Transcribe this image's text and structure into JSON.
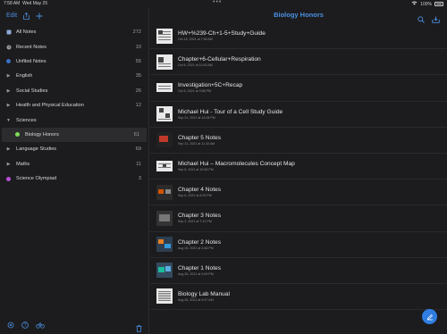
{
  "status": {
    "time": "7:58 AM",
    "date": "Wed May 25",
    "dots": "•••",
    "battery": "100%"
  },
  "sidebar": {
    "edit_label": "Edit",
    "items": [
      {
        "label": "All Notes",
        "count": "272",
        "icon": "all-notes-icon"
      },
      {
        "label": "Recent Notes",
        "count": "10",
        "icon": "clock-icon"
      },
      {
        "label": "Unfiled Notes",
        "count": "55",
        "icon": "unfiled-dot",
        "color": "#3a6fc4"
      },
      {
        "label": "English",
        "count": "35"
      },
      {
        "label": "Social Studies",
        "count": "26"
      },
      {
        "label": "Health and Physical Education",
        "count": "12"
      },
      {
        "label": "Sciences",
        "count": ""
      },
      {
        "label": "Biology Honors",
        "count": "61",
        "color": "#7ed957"
      },
      {
        "label": "Language Studies",
        "count": "69"
      },
      {
        "label": "Maths",
        "count": "11"
      },
      {
        "label": "Science Olympiad",
        "count": "3",
        "color": "#b84fd6"
      }
    ]
  },
  "main": {
    "title": "Biology Honors",
    "notes": [
      {
        "title": "HW+%239-Ch+1-5+Study+Guide",
        "date": "Oct 18, 2021 at 7:56 AM"
      },
      {
        "title": "Chapter+6-Cellular+Respiration",
        "date": "Oct 6, 2021 at 10:43 AM"
      },
      {
        "title": "Investigation+5C+Recap",
        "date": "Oct 5, 2021 at 9:58 PM"
      },
      {
        "title": "Michael Hui - Tour of a Cell Study Guide",
        "date": "Sep 21, 2021 at 12:08 PM"
      },
      {
        "title": "Chapter 5 Notes",
        "date": "Sep 21, 2021 at 11:10 AM"
      },
      {
        "title": "Michael Hui – Macromolecules Concept Map",
        "date": "Sep 8, 2021 at 10:38 PM"
      },
      {
        "title": "Chapter 4 Notes",
        "date": "Sep 6, 2021 at 8:29 PM"
      },
      {
        "title": "Chapter 3 Notes",
        "date": "Sep 2, 2021 at 7:12 PM"
      },
      {
        "title": "Chapter 2 Notes",
        "date": "Aug 26, 2021 at 3:48 PM"
      },
      {
        "title": "Chapter 1 Notes",
        "date": "Aug 26, 2021 at 3:09 PM"
      },
      {
        "title": "Biology Lab Manual",
        "date": "Aug 26, 2021 at 9:47 AM"
      }
    ]
  },
  "colors": {
    "accent": "#4a90e2",
    "fab": "#2f7de1"
  }
}
